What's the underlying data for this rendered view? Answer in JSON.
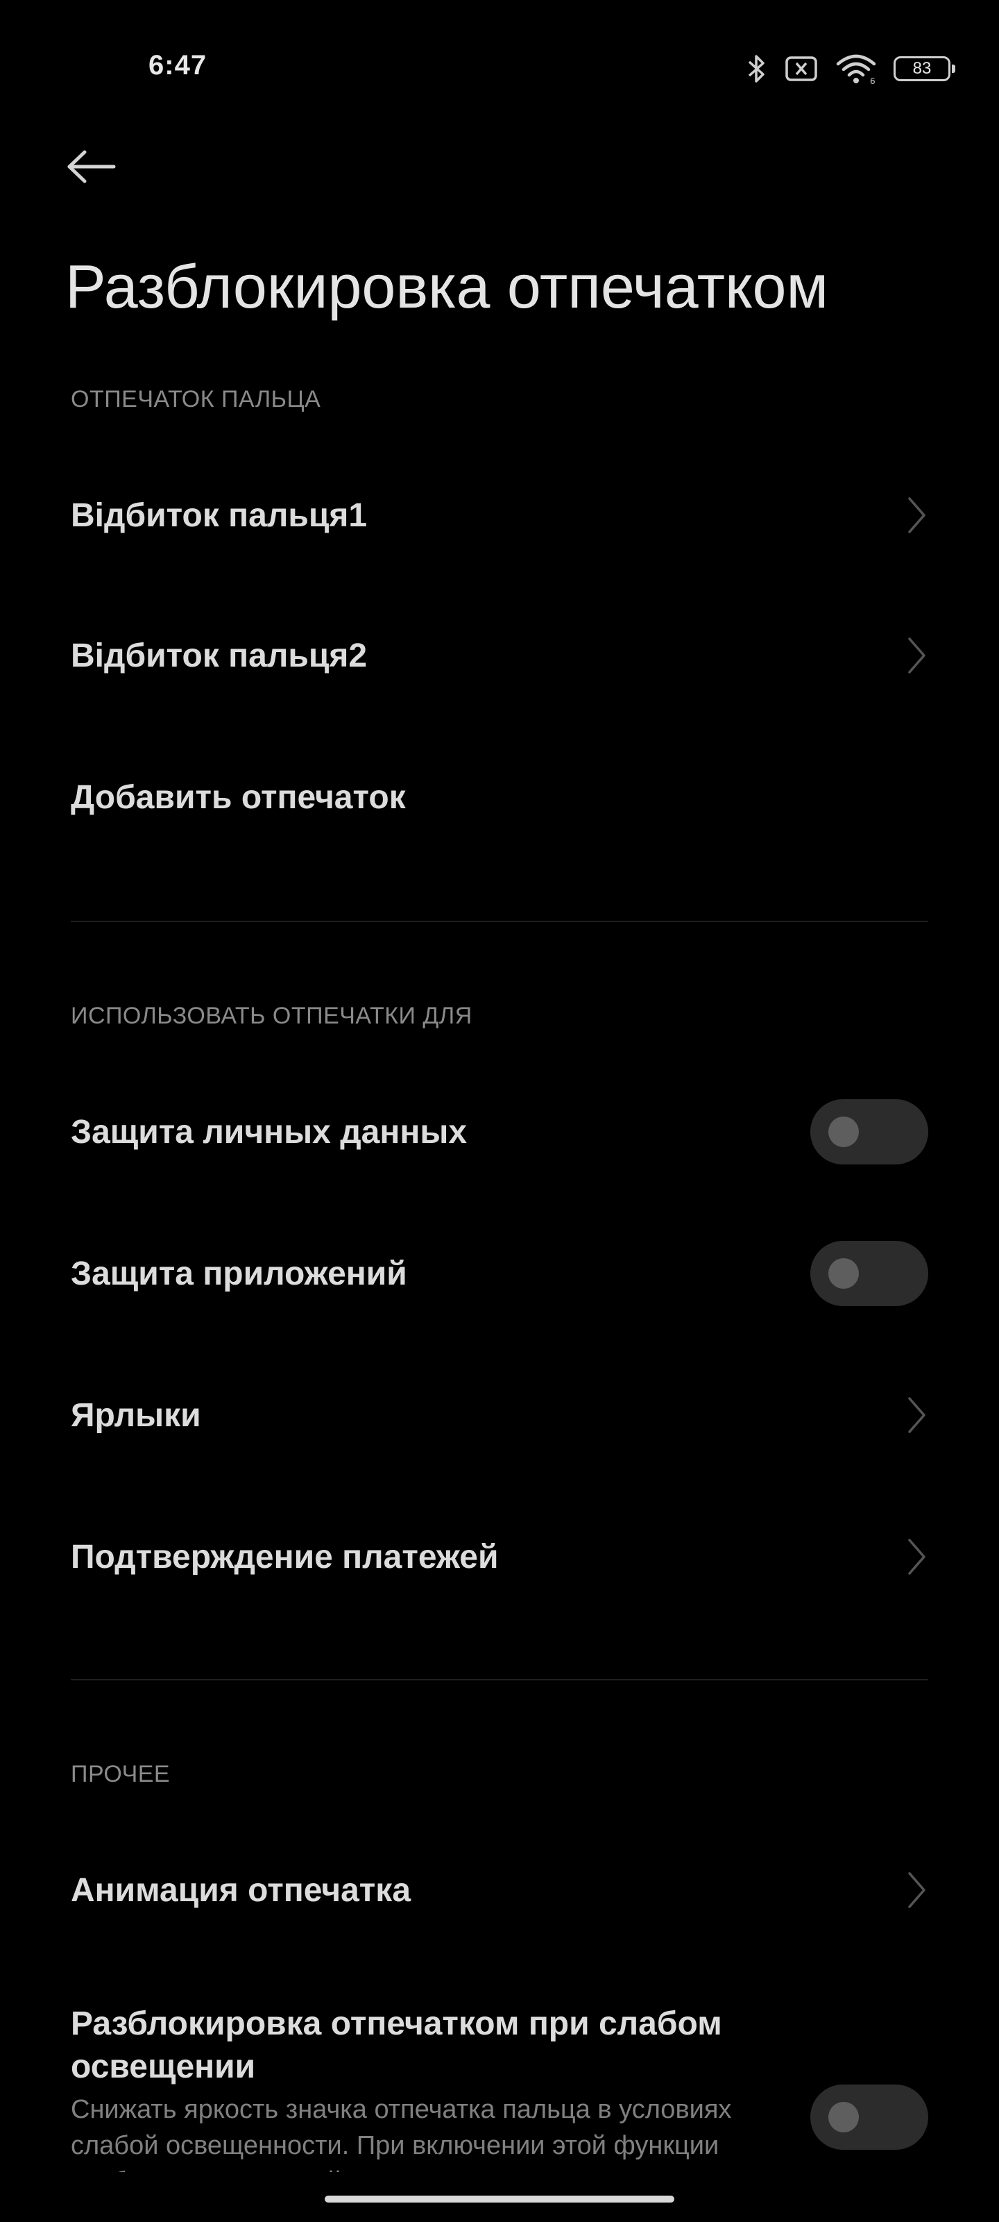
{
  "status_bar": {
    "time": "6:47",
    "battery": "83",
    "icons": [
      "bluetooth-icon",
      "no-sim-icon",
      "wifi-icon",
      "battery-icon"
    ]
  },
  "header": {
    "title": "Разблокировка отпечатком"
  },
  "sections": {
    "fingerprints": {
      "header": "ОТПЕЧАТОК ПАЛЬЦА",
      "items": [
        {
          "label": "Відбиток пальця1"
        },
        {
          "label": "Відбиток пальця2"
        },
        {
          "label": "Добавить отпечаток"
        }
      ]
    },
    "use_for": {
      "header": "ИСПОЛЬЗОВАТЬ ОТПЕЧАТКИ ДЛЯ",
      "items": [
        {
          "label": "Защита личных данных",
          "toggle": false
        },
        {
          "label": "Защита приложений",
          "toggle": false
        },
        {
          "label": "Ярлыки"
        },
        {
          "label": "Подтверждение платежей"
        }
      ]
    },
    "other": {
      "header": "ПРОЧЕЕ",
      "items": [
        {
          "label": "Анимация отпечатка"
        },
        {
          "label": "Разблокировка отпечатком при слабом освещении",
          "description": "Снижать яркость значка отпечатка пальца в условиях слабой освещенности. При включении этой функции разблокировка устройства может",
          "toggle": false
        }
      ]
    }
  },
  "colors": {
    "background": "#000000",
    "text_primary": "#dcdcdc",
    "text_secondary": "#8a8a8a",
    "toggle_track": "#2c2c2c",
    "toggle_knob": "#5e5e5e"
  }
}
